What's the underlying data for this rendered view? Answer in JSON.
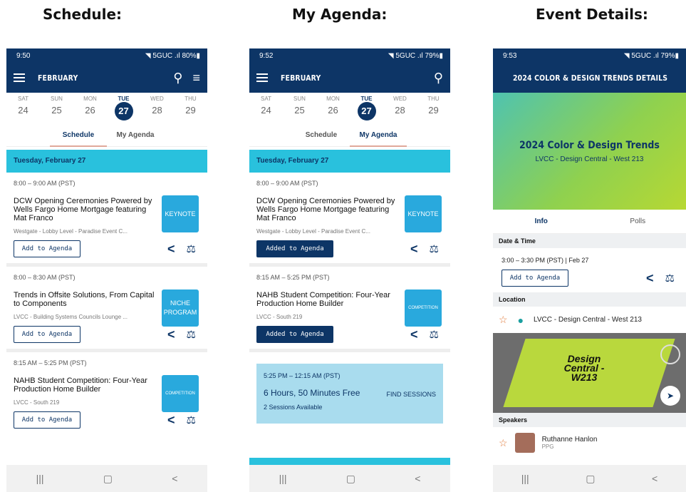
{
  "captions": [
    "Schedule:",
    "My Agenda:",
    "Event Details:"
  ],
  "colors": {
    "primary": "#0d3566",
    "accent": "#29c1dd",
    "tag": "#29a9dd"
  },
  "status": [
    {
      "time": "9:50",
      "right": "◥ 5GUC .ıl 80%▮"
    },
    {
      "time": "9:52",
      "right": "◥ 5GUC .ıl 79%▮"
    },
    {
      "time": "9:53",
      "right": "◥ 5GUC .ıl 79%▮"
    }
  ],
  "month": "FEBRUARY",
  "days": [
    {
      "name": "SAT",
      "num": "24"
    },
    {
      "name": "SUN",
      "num": "25"
    },
    {
      "name": "MON",
      "num": "26"
    },
    {
      "name": "TUE",
      "num": "27"
    },
    {
      "name": "WED",
      "num": "28"
    },
    {
      "name": "THU",
      "num": "29"
    }
  ],
  "tabs": {
    "schedule": "Schedule",
    "agenda": "My Agenda"
  },
  "day_header": "Tuesday, February 27",
  "sessions": [
    {
      "time": "8:00 – 9:00 AM (PST)",
      "title": "DCW Opening Ceremonies Powered by Wells Fargo Home Mortgage featuring Mat Franco",
      "loc": "Westgate - Lobby Level - Paradise Event C...",
      "tag": "KEYNOTE"
    },
    {
      "time": "8:00 – 8:30 AM (PST)",
      "title": "Trends in Offsite Solutions, From Capital to Components",
      "loc": "LVCC - Building Systems Councils Lounge ...",
      "tag": "NICHE PROGRAM"
    },
    {
      "time": "8:15 AM – 5:25 PM (PST)",
      "title": "NAHB Student Competition: Four-Year Production Home Builder",
      "loc": "LVCC - South 219",
      "tag": "COMPETITION"
    }
  ],
  "buttons": {
    "add": "Add to Agenda",
    "added": "Added to Agenda"
  },
  "free": {
    "time": "5:25 PM – 12:15 AM (PST)",
    "duration": "6 Hours, 50 Minutes Free",
    "sessions": "2 Sessions Available",
    "find": "FIND SESSIONS"
  },
  "details": {
    "header": "2024 COLOR & DESIGN TRENDS  DETAILS",
    "title": "2024 Color & Design Trends",
    "location_sub": "LVCC - Design Central - West 213",
    "tab_info": "Info",
    "tab_polls": "Polls",
    "date_label": "Date & Time",
    "date_value": "3:00 – 3:30 PM (PST) | Feb 27",
    "location_label": "Location",
    "location_value": "LVCC - Design Central - West 213",
    "map_label": "Design Central - W213",
    "speakers_label": "Speakers",
    "speaker_name": "Ruthanne Hanlon",
    "speaker_org": "PPG"
  },
  "icons": {
    "menu": "≡",
    "search": "⌕",
    "filter": "☷",
    "share": "<",
    "bell": "⌂",
    "star": "☆",
    "pin": "●",
    "nav_recent": "|||",
    "nav_home": "▢",
    "nav_back": "<",
    "compass": "➤"
  }
}
